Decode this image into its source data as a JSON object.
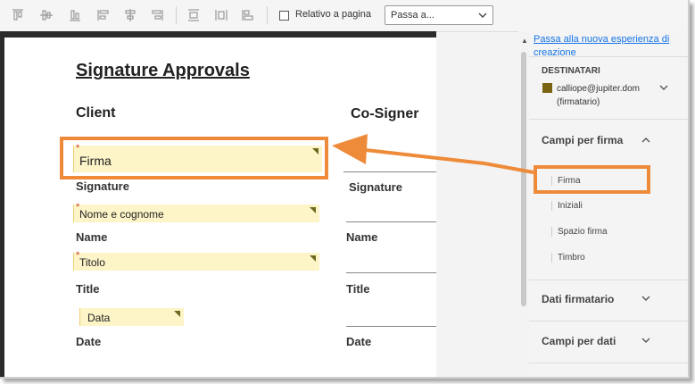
{
  "toolbar": {
    "icons": [
      "align-top-icon",
      "align-vertical-center-icon",
      "align-bottom-icon",
      "align-left-icon",
      "align-horizontal-center-icon",
      "align-right-icon",
      "distribute-vertical-icon",
      "distribute-horizontal-icon",
      "match-size-icon"
    ],
    "relative_label": "Relativo a pagina",
    "goto_select": "Passa a..."
  },
  "document": {
    "title": "Signature Approvals",
    "client_heading": "Client",
    "cosigner_heading": "Co-Signer",
    "fields": {
      "firma": "Firma",
      "nome": "Nome e cognome",
      "titolo": "Titolo",
      "data": "Data"
    },
    "labels": {
      "signature": "Signature",
      "name": "Name",
      "title": "Title",
      "date": "Date"
    }
  },
  "panel": {
    "link": "Passa alla nuova esperienza di creazione",
    "recipients_title": "DESTINATARI",
    "recipient_email": "calliope@jupiter.dom",
    "recipient_role": "(firmatario)",
    "recipient_color": "#7a6414",
    "sections": {
      "signature_fields": "Campi per firma",
      "signer_data": "Dati firmatario",
      "data_fields": "Campi per dati"
    },
    "signature_items": [
      "Firma",
      "Iniziali",
      "Spazio firma",
      "Timbro"
    ]
  },
  "colors": {
    "highlight": "#ee8b3a",
    "field_bg": "#fdf4c8",
    "link": "#1473e6"
  }
}
